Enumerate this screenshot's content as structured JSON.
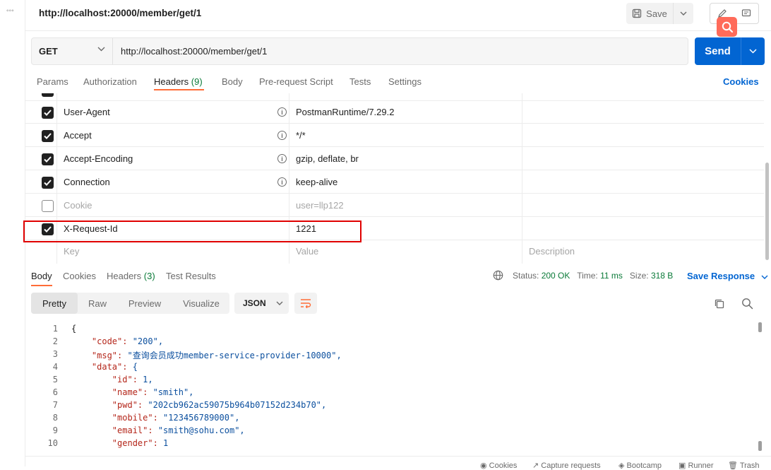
{
  "top": {
    "title": "http://localhost:20000/member/get/1",
    "save_label": "Save"
  },
  "request": {
    "method": "GET",
    "url": "http://localhost:20000/member/get/1",
    "send_label": "Send"
  },
  "req_tabs": {
    "params": "Params",
    "authorization": "Authorization",
    "headers": "Headers",
    "headers_count": "(9)",
    "body": "Body",
    "prerequest": "Pre-request Script",
    "tests": "Tests",
    "settings": "Settings",
    "cookies": "Cookies"
  },
  "headers_table": {
    "rows": [
      {
        "key": "User-Agent",
        "value": "PostmanRuntime/7.29.2",
        "checked": true,
        "info": true
      },
      {
        "key": "Accept",
        "value": "*/*",
        "checked": true,
        "info": true
      },
      {
        "key": "Accept-Encoding",
        "value": "gzip, deflate, br",
        "checked": true,
        "info": true
      },
      {
        "key": "Connection",
        "value": "keep-alive",
        "checked": true,
        "info": true
      },
      {
        "key": "Cookie",
        "value": "user=llp122",
        "checked": false,
        "info": false
      },
      {
        "key": "X-Request-Id",
        "value": "1221",
        "checked": true,
        "info": false
      }
    ],
    "placeholder_key": "Key",
    "placeholder_value": "Value",
    "placeholder_description": "Description"
  },
  "response": {
    "tabs": {
      "body": "Body",
      "cookies": "Cookies",
      "headers": "Headers",
      "headers_count": "(3)",
      "test_results": "Test Results"
    },
    "status_label": "Status:",
    "status_value": "200 OK",
    "time_label": "Time:",
    "time_value": "11 ms",
    "size_label": "Size:",
    "size_value": "318 B",
    "save_response": "Save Response",
    "views": [
      "Pretty",
      "Raw",
      "Preview",
      "Visualize"
    ],
    "format": "JSON"
  },
  "code_lines": [
    {
      "n": "1",
      "text": "{"
    },
    {
      "n": "2",
      "text": "    \"code\": \"200\","
    },
    {
      "n": "3",
      "text": "    \"msg\": \"查询会员成功member-service-provider-10000\","
    },
    {
      "n": "4",
      "text": "    \"data\": {"
    },
    {
      "n": "5",
      "text": "        \"id\": 1,"
    },
    {
      "n": "6",
      "text": "        \"name\": \"smith\","
    },
    {
      "n": "7",
      "text": "        \"pwd\": \"202cb962ac59075b964b07152d234b70\","
    },
    {
      "n": "8",
      "text": "        \"mobile\": \"123456789000\","
    },
    {
      "n": "9",
      "text": "        \"email\": \"smith@sohu.com\","
    },
    {
      "n": "10",
      "text": "        \"gender\": 1"
    }
  ],
  "footer": {
    "cookies": "Cookies",
    "capture": "Capture requests",
    "bootcamp": "Bootcamp",
    "runner": "Runner",
    "trash": "Trash"
  },
  "colors": {
    "accent": "#ff6c37",
    "primary": "#0265d2",
    "success": "#0a7a38"
  }
}
